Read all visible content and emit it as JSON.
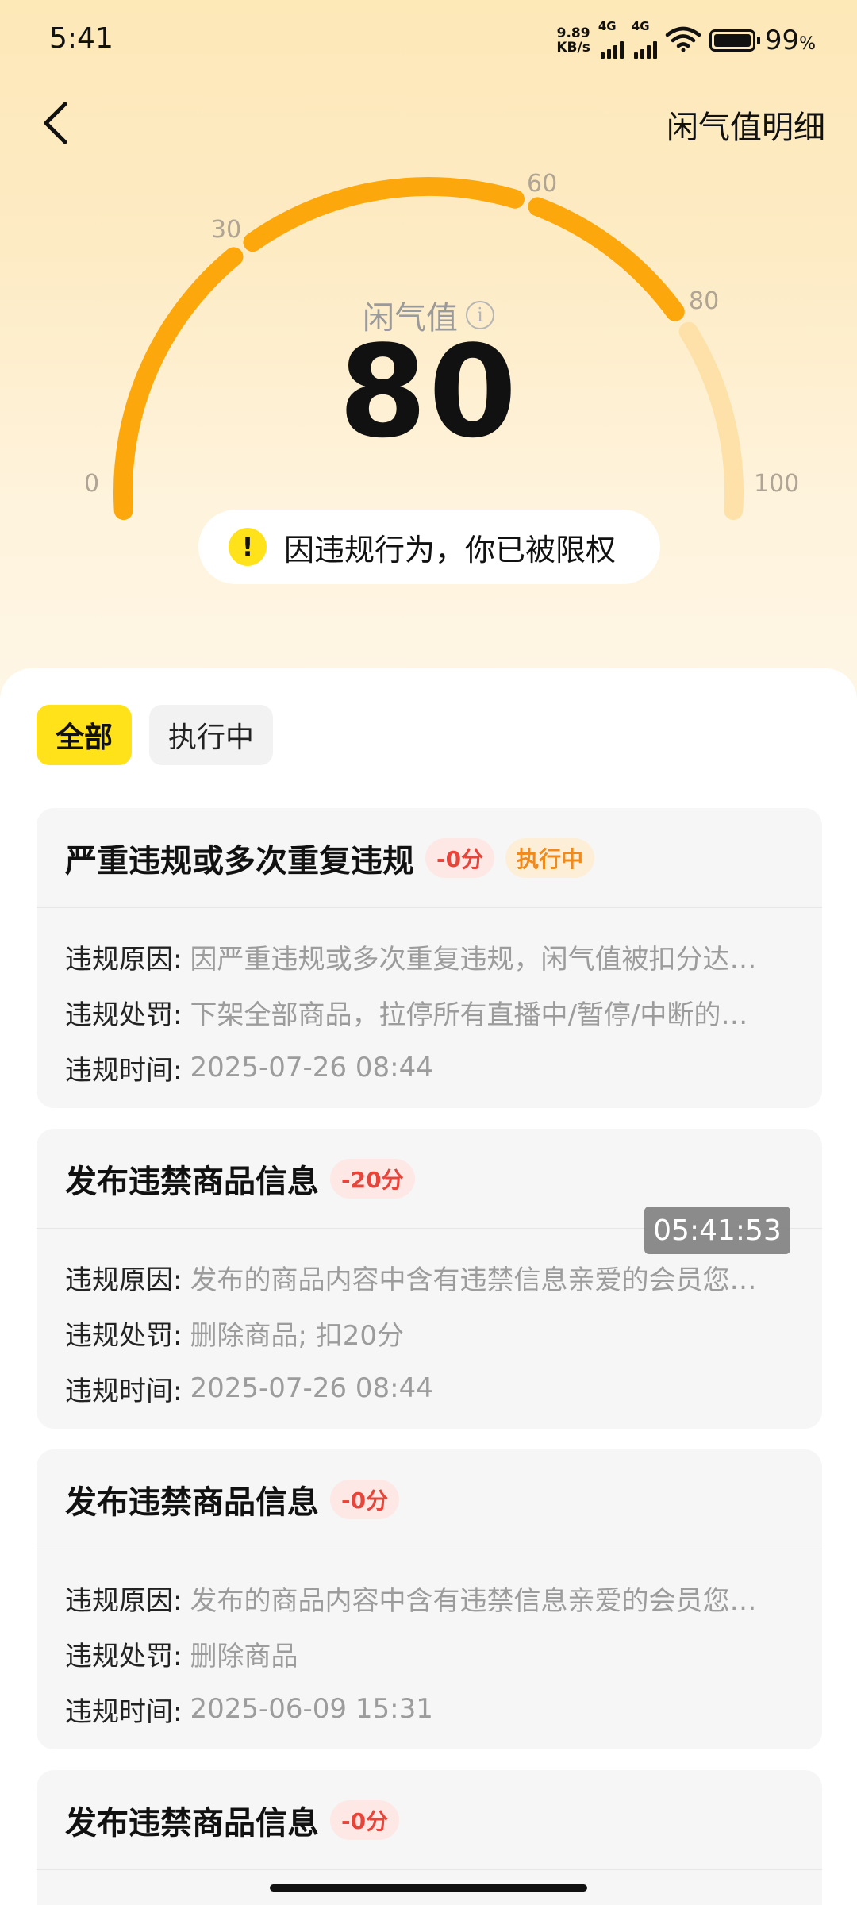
{
  "status_bar": {
    "time": "5:41",
    "net_speed_value": "9.89",
    "net_speed_unit": "KB/s",
    "sim1_label": "4G",
    "sim2_label": "4G",
    "wifi_icon": "wifi-icon",
    "battery_percent": "99",
    "battery_percent_sign": "%"
  },
  "nav": {
    "back_icon": "chevron-left-icon",
    "detail_link": "闲气值明细"
  },
  "gauge": {
    "label": "闲气值",
    "info_icon": "info-icon",
    "value": "80",
    "max": 100,
    "ticks": [
      "0",
      "30",
      "60",
      "80",
      "100"
    ],
    "filled_color": "#fca80d",
    "track_color": "#fde1a8"
  },
  "warning": {
    "icon_glyph": "!",
    "text": "因违规行为，你已被限权"
  },
  "tabs": [
    {
      "label": "全部",
      "active": true
    },
    {
      "label": "执行中",
      "active": false
    }
  ],
  "records": [
    {
      "title": "严重违规或多次重复违规",
      "score": "-0分",
      "status": "执行中",
      "reason_label": "违规原因:",
      "reason": "因严重违规或多次重复违规，闲气值被扣分达…",
      "penalty_label": "违规处罚:",
      "penalty": "下架全部商品，拉停所有直播中/暂停/中断的…",
      "time_label": "违规时间:",
      "time": "2025-07-26 08:44"
    },
    {
      "title": "发布违禁商品信息",
      "score": "-20分",
      "status": "",
      "reason_label": "违规原因:",
      "reason": "发布的商品内容中含有违禁信息亲爱的会员您…",
      "penalty_label": "违规处罚:",
      "penalty": "删除商品; 扣20分",
      "time_label": "违规时间:",
      "time": "2025-07-26 08:44"
    },
    {
      "title": "发布违禁商品信息",
      "score": "-0分",
      "status": "",
      "reason_label": "违规原因:",
      "reason": "发布的商品内容中含有违禁信息亲爱的会员您…",
      "penalty_label": "违规处罚:",
      "penalty": "删除商品",
      "time_label": "违规时间:",
      "time": "2025-06-09 15:31"
    },
    {
      "title": "发布违禁商品信息",
      "score": "-0分"
    }
  ],
  "overlay_timer": "05:41:53"
}
